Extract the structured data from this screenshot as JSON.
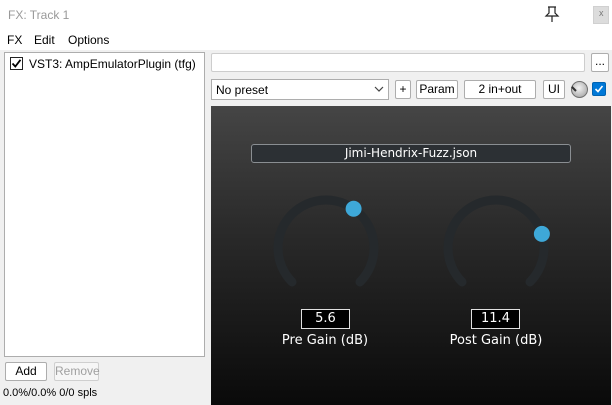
{
  "window": {
    "title": "FX: Track 1",
    "close_glyph": "x"
  },
  "menu": [
    "FX",
    "Edit",
    "Options"
  ],
  "fx_list": [
    {
      "label": "VST3: AmpEmulatorPlugin (tfg)",
      "enabled": true
    }
  ],
  "buttons": {
    "add": "Add",
    "remove": "Remove"
  },
  "status": "0.0%/0.0% 0/0 spls",
  "toolbar": {
    "more": "...",
    "preset": "No preset",
    "plus": "+",
    "param": "Param",
    "io": "2 in+out",
    "ui": "UI"
  },
  "plugin": {
    "preset_name": "Jimi-Hendrix-Fuzz.json",
    "knobs": [
      {
        "label": "Pre Gain (dB)",
        "value": "5.6",
        "position": 0.63
      },
      {
        "label": "Post Gain (dB)",
        "value": "11.4",
        "position": 0.77
      }
    ],
    "accent_color": "#3ea8d8",
    "track_color": "#25292c"
  }
}
